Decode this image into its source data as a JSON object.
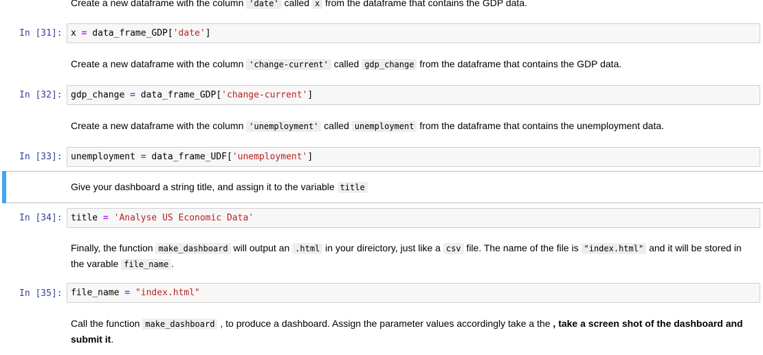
{
  "md0": {
    "t1": "Create a new dataframe with the column ",
    "c1": "'date'",
    "t2": " called ",
    "c2": "x",
    "t3": " from the dataframe that contains the GDP data."
  },
  "cell31": {
    "prompt": "In [31]:",
    "var": "x",
    "eq": "=",
    "pre": " data_frame_GDP[",
    "str": "'date'",
    "post": "]"
  },
  "md1": {
    "t1": "Create a new dataframe with the column ",
    "c1": "'change-current'",
    "t2": " called ",
    "c2": "gdp_change",
    "t3": " from the dataframe that contains the GDP data."
  },
  "cell32": {
    "prompt": "In [32]:",
    "var": "gdp_change",
    "eq": "=",
    "pre": " data_frame_GDP[",
    "str": "'change-current'",
    "post": "]"
  },
  "md2": {
    "t1": "Create a new dataframe with the column ",
    "c1": "'unemployment'",
    "t2": " called ",
    "c2": "unemployment",
    "t3": " from the dataframe that contains the unemployment data."
  },
  "cell33": {
    "prompt": "In [33]:",
    "var": "unemployment",
    "eq": "=",
    "pre": " data_frame_UDF[",
    "str": "'unemployment'",
    "post": "]"
  },
  "md3": {
    "t1": "Give your dashboard a string title, and assign it to the variable ",
    "c1": "title"
  },
  "cell34": {
    "prompt": "In [34]:",
    "var": "title",
    "eq": "=",
    "str": "'Analyse US Economic Data'"
  },
  "md4": {
    "t1": "Finally, the function ",
    "c1": "make_dashboard",
    "t2": " will output an ",
    "c2": ".html",
    "t3": " in your direictory, just like a ",
    "c3": "csv",
    "t4": " file. The name of the file is ",
    "c4": "\"index.html\"",
    "t5": " and it will be stored in the varable ",
    "c5": "file_name",
    "t6": "."
  },
  "cell35": {
    "prompt": "In [35]:",
    "var": "file_name",
    "eq": "=",
    "str": "\"index.html\""
  },
  "md5": {
    "t1": "Call the function ",
    "c1": "make_dashboard",
    "t2": " , to produce a dashboard. Assign the parameter values accordingly take a the ",
    "b1": ", take a screen shot of the dashboard and submit it",
    "t3": "."
  }
}
